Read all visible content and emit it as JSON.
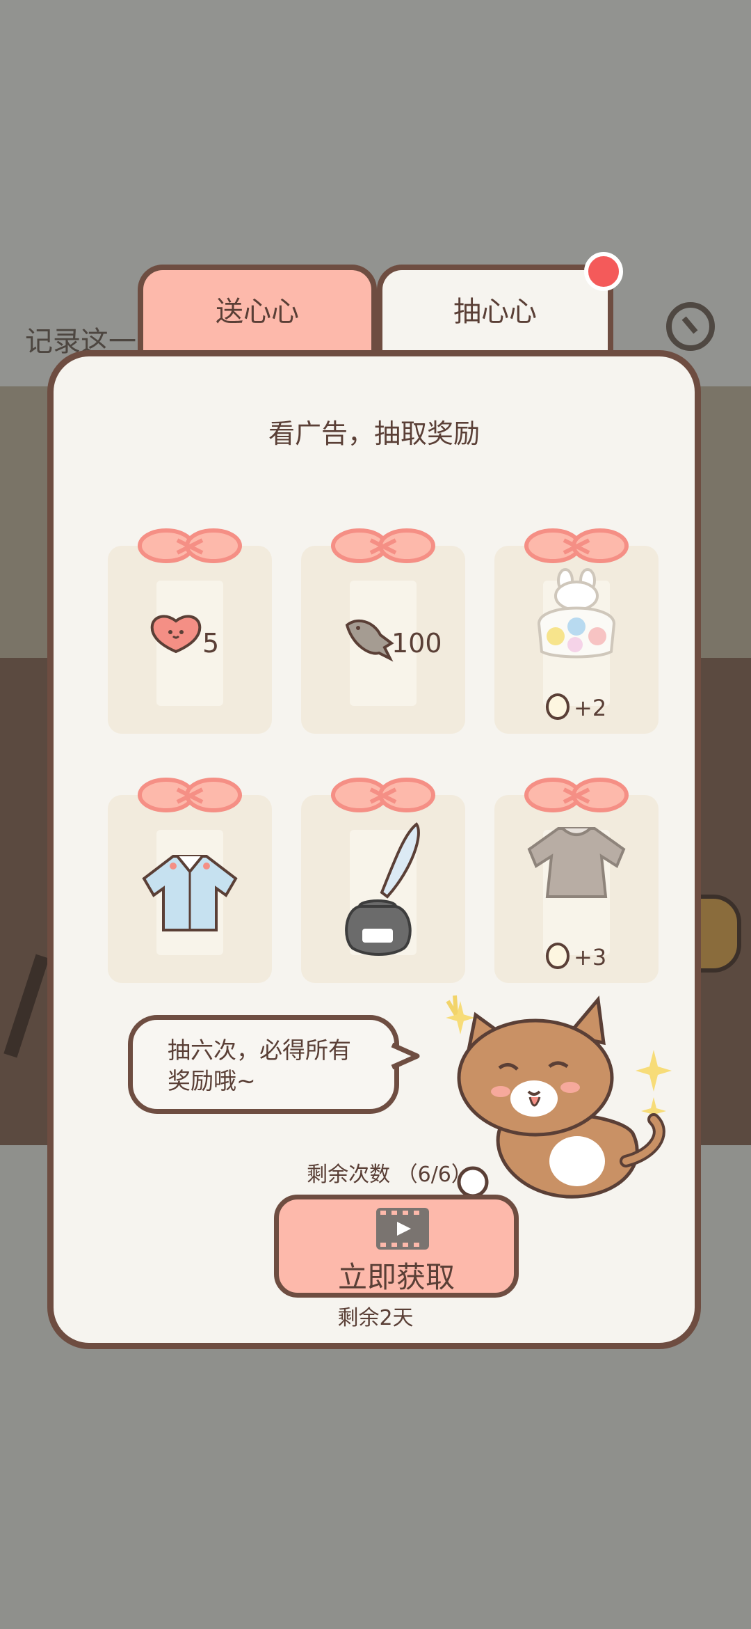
{
  "background": {
    "title": "记录这一"
  },
  "tabs": [
    {
      "label": "送心心",
      "active": false
    },
    {
      "label": "抽心心",
      "active": true
    }
  ],
  "panel": {
    "title": "看广告，抽取奖励"
  },
  "rewards": [
    {
      "item": "heart-icon",
      "label": "5",
      "bonus": ""
    },
    {
      "item": "fish-icon",
      "label": "100",
      "bonus": ""
    },
    {
      "item": "gacha-jar-icon",
      "label": "",
      "bonus": "+2"
    },
    {
      "item": "jacket-icon",
      "label": "",
      "bonus": ""
    },
    {
      "item": "quill-inkpot-icon",
      "label": "",
      "bonus": ""
    },
    {
      "item": "cardigan-icon",
      "label": "",
      "bonus": "+3"
    }
  ],
  "bubble": {
    "line1": "抽六次，必得所有",
    "line2": "奖励哦~"
  },
  "footer": {
    "remain_count": "剩余次数 （6/6）",
    "cta_label": "立即获取",
    "remain_days": "剩余2天"
  },
  "colors": {
    "accent_pink": "#fdb9ab",
    "outline_brown": "#6e4d41",
    "panel_bg": "#f6f4ef",
    "notify_red": "#f45a5a"
  }
}
